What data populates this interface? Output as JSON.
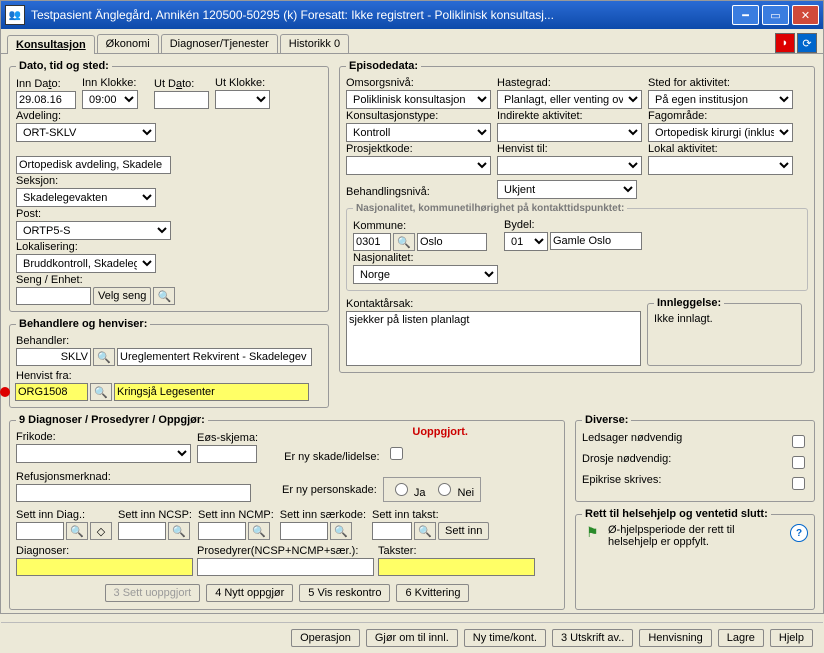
{
  "title": "Testpasient Änglegård, Annikén  120500-50295 (k)  Foresatt: Ikke registrert - Poliklinisk konsultasj...",
  "tabs": {
    "t1": "Konsultasjon",
    "t2": "Økonomi",
    "t3": "Diagnoser/Tjenester",
    "t4": "Historikk 0"
  },
  "tabs_u": {
    "t1": "K",
    "t2": "Ø",
    "t3": "D",
    "t4": "0"
  },
  "dato": {
    "legend": "Dato, tid og sted:",
    "inn_dato_lbl": "Inn Dato:",
    "inn_dato": "29.08.16",
    "inn_klokke_lbl": "Inn Klokke:",
    "inn_klokke": "09:00",
    "ut_dato_lbl": "Ut Dato:",
    "ut_dato": "",
    "ut_klokke_lbl": "Ut Klokke:",
    "ut_klokke": "",
    "avdeling_lbl": "Avdeling:",
    "avdeling": "ORT-SKLV",
    "avdeling_ro": "Ortopedisk avdeling, Skadele",
    "seksjon_lbl": "Seksjon:",
    "seksjon": "Skadelegevakten",
    "post_lbl": "Post:",
    "post": "ORTP5-S",
    "lokal_lbl": "Lokalisering:",
    "lokal": "Bruddkontroll, Skadelege",
    "seng_lbl": "Seng / Enhet:",
    "seng": "",
    "velg": "Velg seng"
  },
  "beh": {
    "legend": "Behandlere og henviser:",
    "behandler_lbl": "Behandler:",
    "behandler": "SKLV",
    "beh_ro": "Ureglementert Rekvirent - Skadelegev",
    "henvist_lbl": "Henvist fra:",
    "henvist": "ORG1508",
    "henvist_ro": "Kringsjå Legesenter"
  },
  "epi": {
    "legend": "Episodedata:",
    "oms_lbl": "Omsorgsnivå:",
    "oms": "Poliklinisk konsultasjon",
    "haste_lbl": "Hastegrad:",
    "haste": "Planlagt, eller venting ove",
    "sted_lbl": "Sted for aktivitet:",
    "sted": "På egen institusjon",
    "kons_lbl": "Konsultasjonstype:",
    "kons": "Kontroll",
    "ind_lbl": "Indirekte aktivitet:",
    "ind": "",
    "fag_lbl": "Fagområde:",
    "fag": "Ortopedisk kirurgi (inklusi",
    "pros_lbl": "Prosjektkode:",
    "pros": "",
    "hen_lbl": "Henvist til:",
    "hen": "",
    "lokakt_lbl": "Lokal aktivitet:",
    "lokakt": "",
    "behniv_lbl": "Behandlingsnivå:",
    "behniv": "Ukjent",
    "nasj_hdr": "Nasjonalitet, kommunetilhørighet på kontakttidspunktet:",
    "kom_lbl": "Kommune:",
    "kom": "0301",
    "kom_nm": "Oslo",
    "byd_lbl": "Bydel:",
    "byd": "01",
    "byd_nm": "Gamle Oslo",
    "nasj_lbl": "Nasjonalitet:",
    "nasj": "Norge",
    "kar_lbl": "Kontaktårsak:",
    "kar": "sjekker på listen planlagt",
    "innl_lbl": "Innleggelse:",
    "innl": "Ikke innlagt."
  },
  "diag": {
    "legend": "9 Diagnoser / Prosedyrer / Oppgjør:",
    "uopp": "Uoppgjort.",
    "fri_lbl": "Frikode:",
    "eos_lbl": "Eøs-skjema:",
    "skade_lbl": "Er ny skade/lidelse:",
    "person_lbl": "Er ny personskade:",
    "ja": "Ja",
    "nei": "Nei",
    "ref_lbl": "Refusjonsmerknad:",
    "sdiag_lbl": "Sett inn Diag.:",
    "sncsp_lbl": "Sett inn NCSP:",
    "sncmp_lbl": "Sett inn NCMP:",
    "ssaer_lbl": "Sett inn særkode:",
    "stakst_lbl": "Sett inn takst:",
    "settinn": "Sett inn",
    "diagnoser_lbl": "Diagnoser:",
    "pros_lbl": "Prosedyrer(NCSP+NCMP+sær.):",
    "takster_lbl": "Takster:",
    "b3": "3 Sett uoppgjort",
    "b4": "4 Nytt oppgjør",
    "b5": "5 Vis reskontro",
    "b6": "6 Kvittering"
  },
  "div": {
    "legend": "Diverse:",
    "leds": "Ledsager nødvendig",
    "dros": "Drosje nødvendig:",
    "epik": "Epikrise skrives:"
  },
  "rett": {
    "legend": "Rett til helsehjelp og ventetid slutt:",
    "txt": "Ø-hjelpsperiode der rett til helsehjelp er oppfylt."
  },
  "bar": {
    "op": "Operasjon",
    "gjor": "Gjør om til innl.",
    "ny": "Ny time/kont.",
    "ut": "3 Utskrift av..",
    "hen": "Henvisning",
    "lagre": "Lagre",
    "hjelp": "Hjelp"
  }
}
